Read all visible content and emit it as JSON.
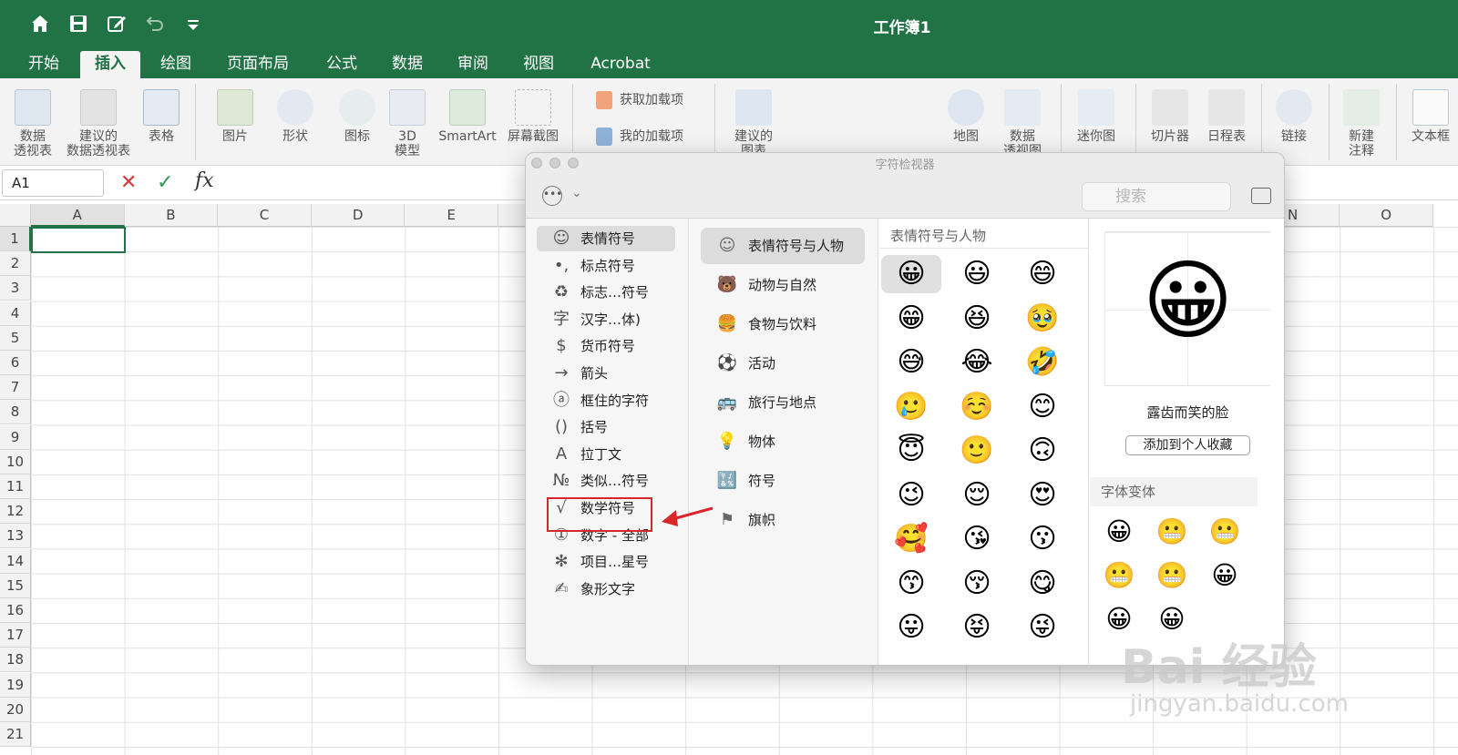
{
  "window": {
    "title": "工作簿1"
  },
  "tabs": [
    "开始",
    "插入",
    "绘图",
    "页面布局",
    "公式",
    "数据",
    "审阅",
    "视图",
    "Acrobat"
  ],
  "ribbon": {
    "pivot": "数据\n透视表",
    "recommended_pivot": "建议的\n数据透视表",
    "table": "表格",
    "pictures": "图片",
    "shapes": "形状",
    "icons": "图标",
    "models": "3D\n模型",
    "smartart": "SmartArt",
    "screenshot": "屏幕截图",
    "get_addins": "获取加载项",
    "my_addins": "我的加载项",
    "recommended_charts": "建议的\n图表",
    "maps": "地图",
    "pivot_chart": "数据\n透视图",
    "sparklines": "迷你图",
    "slicer": "切片器",
    "timeline": "日程表",
    "link": "链接",
    "new_comment": "新建\n注释",
    "textbox": "文本框"
  },
  "formula_bar": {
    "name_box": "A1",
    "fx": "fx",
    "cancel": "✕",
    "ok": "✓"
  },
  "columns": [
    "A",
    "B",
    "C",
    "D",
    "E",
    "",
    "",
    "",
    "",
    "",
    "",
    "",
    "",
    "N",
    "O"
  ],
  "rows": [
    "1",
    "2",
    "3",
    "4",
    "5",
    "6",
    "7",
    "8",
    "9",
    "10",
    "11",
    "12",
    "13",
    "14",
    "15",
    "16",
    "17",
    "18",
    "19",
    "20",
    "21"
  ],
  "viewer": {
    "title": "字符检视器",
    "search_placeholder": "搜索",
    "categories": [
      {
        "glyph": "☺",
        "label": "表情符号"
      },
      {
        "glyph": "•,",
        "label": "标点符号"
      },
      {
        "glyph": "♻",
        "label": "标志…符号"
      },
      {
        "glyph": "字",
        "label": "汉字…体)"
      },
      {
        "glyph": "$",
        "label": "货币符号"
      },
      {
        "glyph": "→",
        "label": "箭头"
      },
      {
        "glyph": "ⓐ",
        "label": "框住的字符"
      },
      {
        "glyph": "()",
        "label": "括号"
      },
      {
        "glyph": "A",
        "label": "拉丁文"
      },
      {
        "glyph": "№",
        "label": "类似…符号"
      },
      {
        "glyph": "√",
        "label": "数学符号"
      },
      {
        "glyph": "①",
        "label": "数字 - 全部"
      },
      {
        "glyph": "✻",
        "label": "项目…星号"
      },
      {
        "glyph": "✍",
        "label": "象形文字"
      }
    ],
    "subcategories": [
      {
        "glyph": "☺",
        "label": "表情符号与人物"
      },
      {
        "glyph": "🐻",
        "label": "动物与自然"
      },
      {
        "glyph": "🍔",
        "label": "食物与饮料"
      },
      {
        "glyph": "⚽",
        "label": "活动"
      },
      {
        "glyph": "🚌",
        "label": "旅行与地点"
      },
      {
        "glyph": "💡",
        "label": "物体"
      },
      {
        "glyph": "🔣",
        "label": "符号"
      },
      {
        "glyph": "⚑",
        "label": "旗帜"
      }
    ],
    "grid_title": "表情符号与人物",
    "emojis": [
      "😀",
      "😃",
      "😄",
      "😁",
      "😆",
      "🥹",
      "😅",
      "😂",
      "🤣",
      "🥲",
      "☺️",
      "😊",
      "😇",
      "🙂",
      "🙃",
      "😉",
      "😌",
      "😍",
      "🥰",
      "😘",
      "😗",
      "😙",
      "😚",
      "😋",
      "😛",
      "😝",
      "😜"
    ],
    "preview": {
      "emoji": "😀",
      "name": "露齿而笑的脸",
      "add_favorite": "添加到个人收藏"
    },
    "variants_title": "字体变体",
    "variants": [
      "😀",
      "😬",
      "😬",
      "😬",
      "😬",
      "😀",
      "😀",
      "😀"
    ]
  },
  "watermark": {
    "brand": "Bai 经验",
    "url": "jingyan.baidu.com"
  },
  "colors": {
    "excel_green": "#217346",
    "highlight_red": "#d9262b"
  }
}
